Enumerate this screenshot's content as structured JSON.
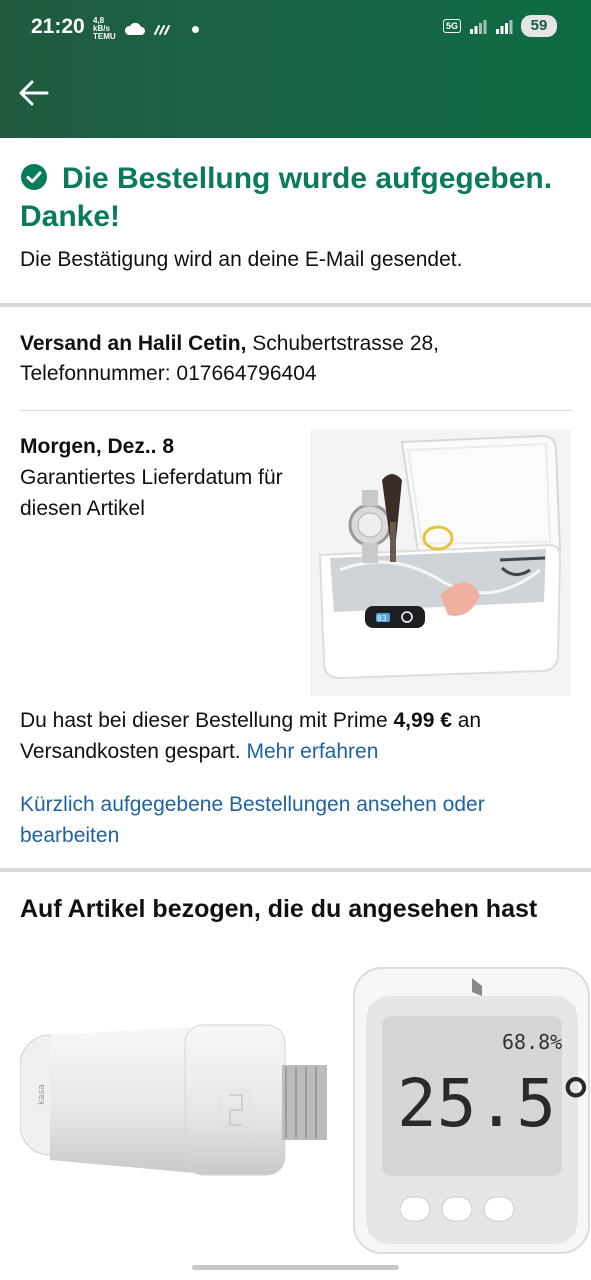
{
  "status_bar": {
    "time": "21:20",
    "mini_label": "4,8 kB/s TEMU",
    "signal": "5G",
    "battery": "59"
  },
  "confirmation": {
    "title": "Die Bestellung wurde aufgegeben. Danke!",
    "subtitle": "Die Bestätigung wird an deine E-Mail gesendet.",
    "accent_color": "#0a7b5a"
  },
  "shipping": {
    "name": "Versand an Halil Cetin,",
    "address": " Schubertstrasse 28,",
    "phone": "Telefonnummer: 017664796404"
  },
  "delivery": {
    "date": "Morgen, Dez.. 8",
    "note": "Garantiertes Lieferdatum für diesen Artikel",
    "product_display": "03"
  },
  "prime": {
    "text_before": "Du hast bei dieser Bestellung mit Prime ",
    "amount": "4,99 €",
    "text_after": " an Versandkosten gespart. ",
    "link": "Mehr erfahren"
  },
  "orders_link": "Kürzlich aufgegebene Bestellungen ansehen oder bearbeiten",
  "recommendations": {
    "title": "Auf Artikel bezogen, die du angesehen hast",
    "item1_brand": "kasa",
    "item2_humidity": "68.8%",
    "item2_temperature": "25.5°"
  }
}
